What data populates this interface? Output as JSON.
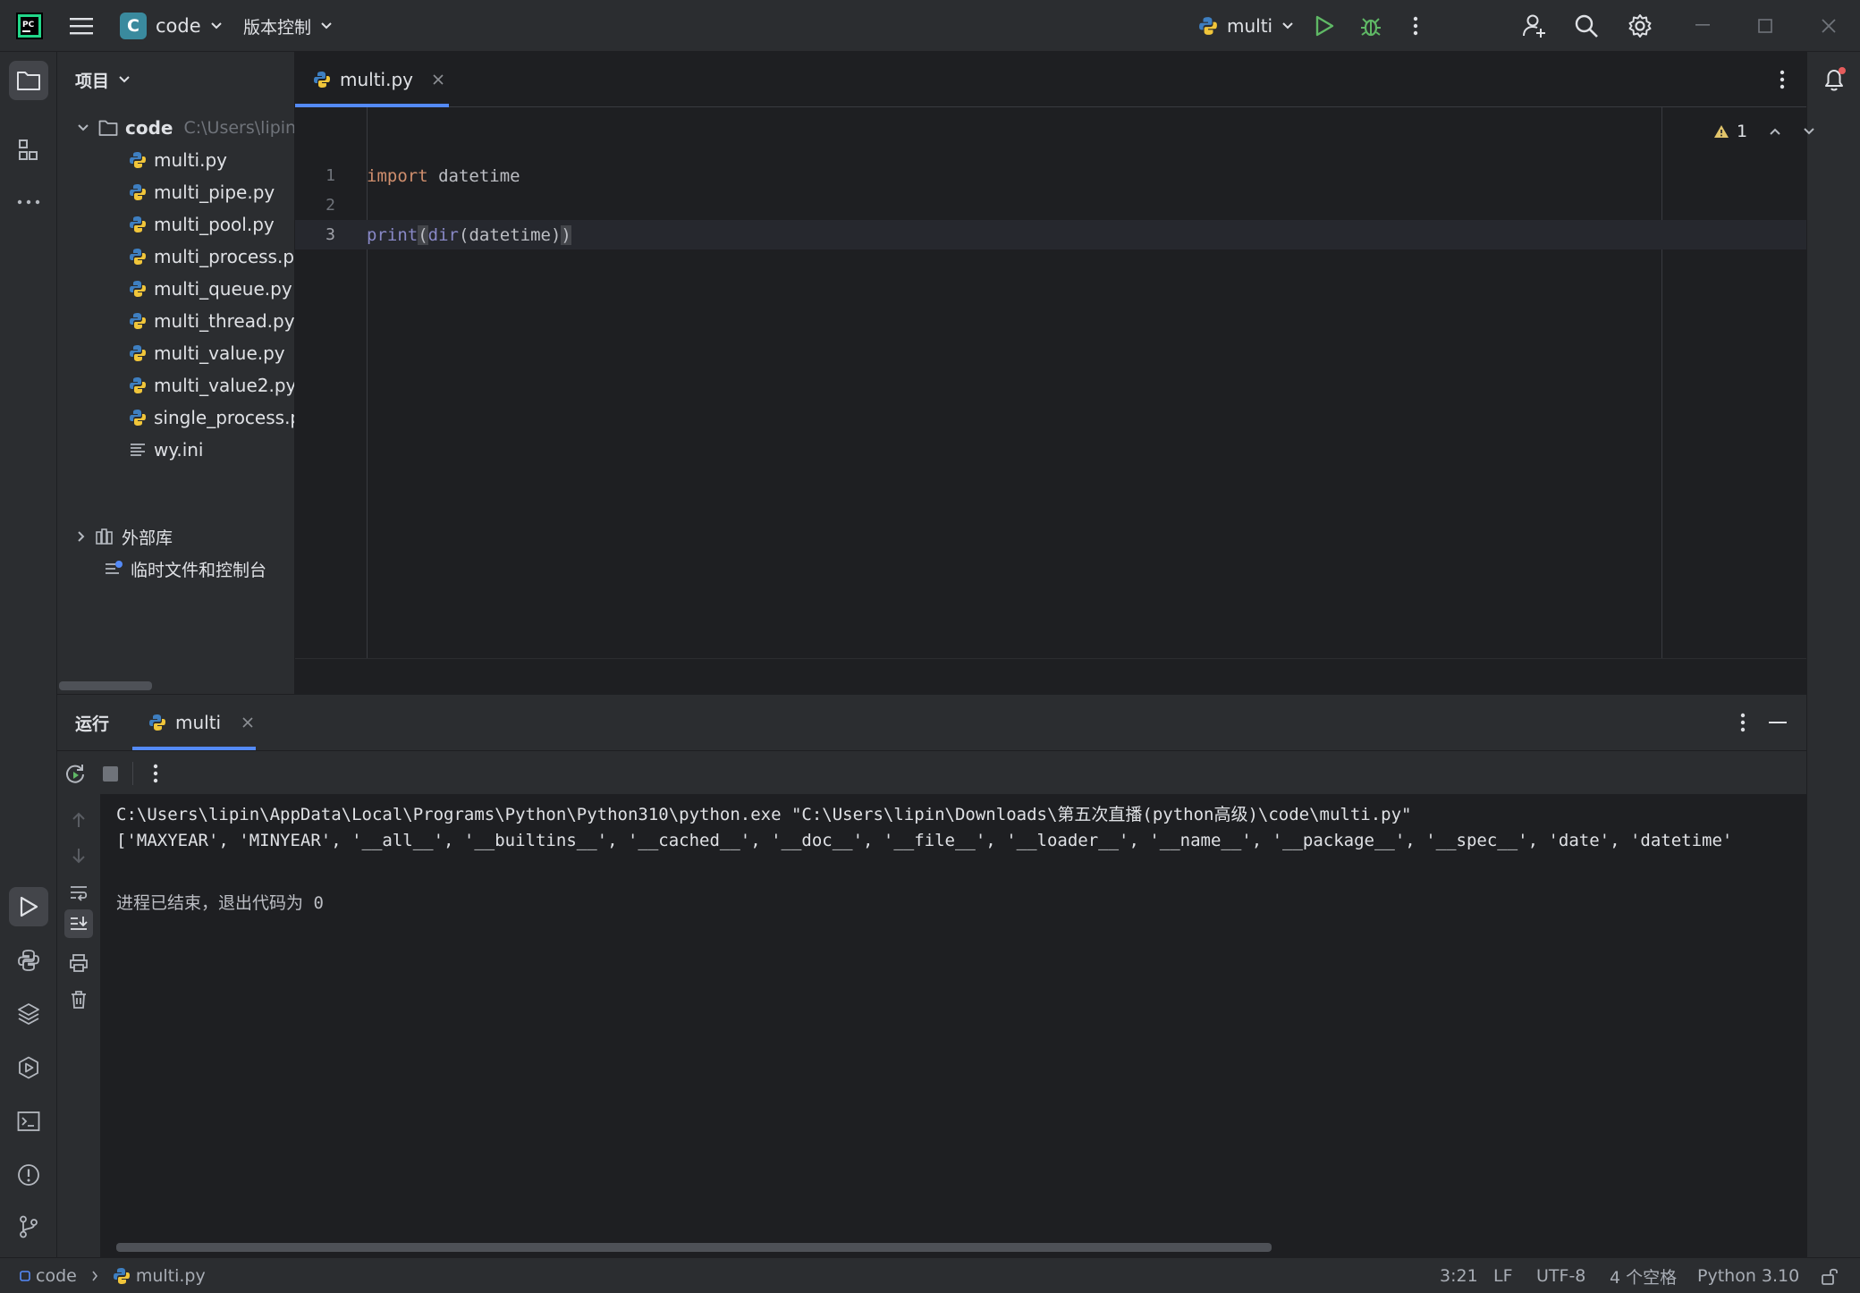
{
  "titlebar": {
    "project_badge": "C",
    "project_name": "code",
    "vcs_menu": "版本控制",
    "run_config": "multi",
    "icons": [
      "pycharm-logo-icon",
      "hamburger-menu-icon",
      "run-icon",
      "debug-icon",
      "more-vertical-icon",
      "add-user-icon",
      "search-icon",
      "gear-icon",
      "minimize-icon",
      "maximize-icon",
      "close-icon"
    ]
  },
  "project_panel": {
    "title": "项目",
    "root": {
      "name": "code",
      "path": "C:\\Users\\lipin\\"
    },
    "files": [
      "multi.py",
      "multi_pipe.py",
      "multi_pool.py",
      "multi_process.py",
      "multi_queue.py",
      "multi_thread.py",
      "multi_value.py",
      "multi_value2.py",
      "single_process.py",
      "wy.ini"
    ],
    "external_libs": "外部库",
    "scratches": "临时文件和控制台"
  },
  "editor": {
    "tab_label": "multi.py",
    "warning_count": "1",
    "lines": [
      {
        "num": "1",
        "keyword": "import",
        "rest": " datetime"
      },
      {
        "num": "2"
      },
      {
        "num": "3",
        "func": "print",
        "open1": "(",
        "builtin": "dir",
        "open2": "(",
        "arg": "datetime",
        "close2": ")",
        "close1": ")"
      }
    ]
  },
  "run_panel": {
    "title": "运行",
    "tab_label": "multi",
    "output": [
      "C:\\Users\\lipin\\AppData\\Local\\Programs\\Python\\Python310\\python.exe \"C:\\Users\\lipin\\Downloads\\第五次直播(python高级)\\code\\multi.py\"",
      "['MAXYEAR', 'MINYEAR', '__all__', '__builtins__', '__cached__', '__doc__', '__file__', '__loader__', '__name__', '__package__', '__spec__', 'date', 'datetime'",
      "",
      "进程已结束，退出代码为 0"
    ]
  },
  "statusbar": {
    "crumb_project": "code",
    "crumb_file": "multi.py",
    "position": "3:21",
    "line_sep": "LF",
    "encoding": "UTF-8",
    "indent": "4 个空格",
    "interpreter": "Python 3.10"
  },
  "colors": {
    "keyword": "#cf8e6d",
    "function": "#56a8f5",
    "builtin": "#8888c6",
    "text": "#bcbec4",
    "run_green": "#5fb865",
    "warning": "#e0c36a"
  }
}
